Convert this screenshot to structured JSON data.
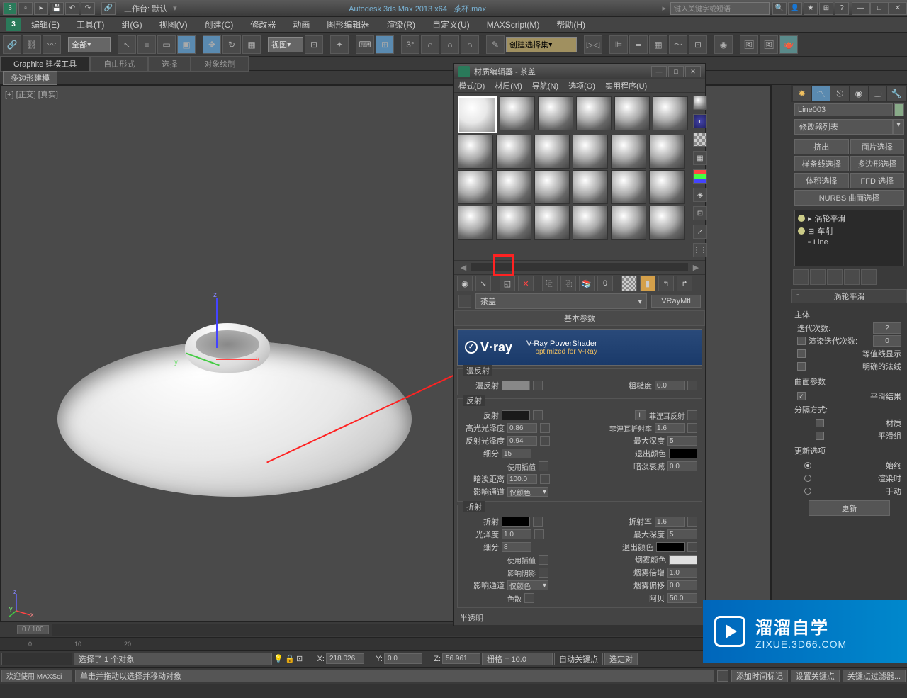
{
  "titlebar": {
    "workspace_label": "工作台: 默认",
    "app_title": "Autodesk 3ds Max  2013 x64",
    "file_name": "茶杯.max",
    "search_placeholder": "键入关键字或短语"
  },
  "menubar": {
    "items": [
      "编辑(E)",
      "工具(T)",
      "组(G)",
      "视图(V)",
      "创建(C)",
      "修改器",
      "动画",
      "图形编辑器",
      "渲染(R)",
      "自定义(U)",
      "MAXScript(M)",
      "帮助(H)"
    ]
  },
  "toolbar": {
    "selection_filter": "全部",
    "view_dropdown": "视图",
    "named_set": "创建选择集"
  },
  "ribbon_tabs": [
    "Graphite 建模工具",
    "自由形式",
    "选择",
    "对象绘制"
  ],
  "ribbon_sub": "多边形建模",
  "viewport": {
    "label": "[+] [正交] [真实]"
  },
  "material_editor": {
    "title": "材质编辑器 - 茶盖",
    "menu": [
      "模式(D)",
      "材质(M)",
      "导航(N)",
      "选项(O)",
      "实用程序(U)"
    ],
    "material_name": "茶盖",
    "material_type": "VRayMtl",
    "rollout_basic": "基本参数",
    "vray_brand": "V·ray",
    "vray_title": "V-Ray PowerShader",
    "vray_sub": "optimized for V-Ray",
    "groups": {
      "diffuse": {
        "title": "漫反射",
        "diffuse_label": "漫反射",
        "roughness_label": "粗糙度",
        "roughness_val": "0.0"
      },
      "reflect": {
        "title": "反射",
        "reflect_label": "反射",
        "hilight_label": "高光光泽度",
        "hilight_val": "0.86",
        "refl_gloss_label": "反射光泽度",
        "refl_gloss_val": "0.94",
        "subdiv_label": "细分",
        "subdiv_val": "15",
        "use_interp_label": "使用插值",
        "dim_dist_label": "暗淡距离",
        "dim_dist_val": "100.0",
        "affect_label": "影响通道",
        "affect_val": "仅颜色",
        "L_label": "L",
        "fresnel_label": "菲涅耳反射",
        "fresnel_ior_label": "菲涅耳折射率",
        "fresnel_ior_val": "1.6",
        "max_depth_label": "最大深度",
        "max_depth_val": "5",
        "exit_color_label": "退出颜色",
        "dim_falloff_label": "暗淡衰减",
        "dim_falloff_val": "0.0"
      },
      "refract": {
        "title": "折射",
        "refract_label": "折射",
        "gloss_label": "光泽度",
        "gloss_val": "1.0",
        "subdiv_label": "细分",
        "subdiv_val": "8",
        "use_interp_label": "使用插值",
        "affect_shadow_label": "影响阴影",
        "affect_label": "影响通道",
        "affect_val": "仅颜色",
        "ior_label": "折射率",
        "ior_val": "1.6",
        "max_depth_label": "最大深度",
        "max_depth_val": "5",
        "exit_color_label": "退出颜色",
        "fog_color_label": "烟雾颜色",
        "fog_mult_label": "烟雾倍增",
        "fog_mult_val": "1.0",
        "fog_bias_label": "烟雾偏移",
        "fog_bias_val": "0.0",
        "dispersion_label": "色散",
        "abbe_label": "阿贝",
        "abbe_val": "50.0"
      },
      "translucency_label": "半透明"
    }
  },
  "modifier_panel": {
    "object_name": "Line003",
    "list_label": "修改器列表",
    "btns": {
      "extrude": "挤出",
      "face_sel": "面片选择",
      "spline_sel": "样条线选择",
      "poly_sel": "多边形选择",
      "vol_sel": "体积选择",
      "ffd_sel": "FFD 选择"
    },
    "nurbs_label": "NURBS  曲面选择",
    "stack": [
      "涡轮平滑",
      "车削",
      "Line"
    ],
    "rollout_title": "涡轮平滑",
    "body_label": "主体",
    "iterations_label": "迭代次数:",
    "iterations_val": "2",
    "render_iter_label": "渲染迭代次数:",
    "render_iter_val": "0",
    "isoline_label": "等值线显示",
    "explicit_label": "明确的法线",
    "surf_params_label": "曲面参数",
    "smooth_result_label": "平滑结果",
    "sep_by_label": "分隔方式:",
    "material_label": "材质",
    "smooth_grp_label": "平滑组",
    "update_opts_label": "更新选项",
    "always_label": "始终",
    "render_label": "渲染时",
    "manual_label": "手动",
    "update_btn": "更新"
  },
  "timeline": {
    "frame": "0 / 100"
  },
  "status": {
    "selection_info": "选择了 1 个对象",
    "x_val": "218.026",
    "y_val": "0.0",
    "z_val": "56.961",
    "grid": "栅格 = 10.0",
    "autokey": "自动关键点",
    "keyfilter": "选定对",
    "welcome": "欢迎使用  MAXSci",
    "prompt": "单击并拖动以选择并移动对象",
    "add_time_tag": "添加时间标记",
    "set_key": "设置关键点",
    "key_filter": "关键点过滤器..."
  },
  "watermark": {
    "brand": "溜溜自学",
    "url": "ZIXUE.3D66.COM"
  }
}
